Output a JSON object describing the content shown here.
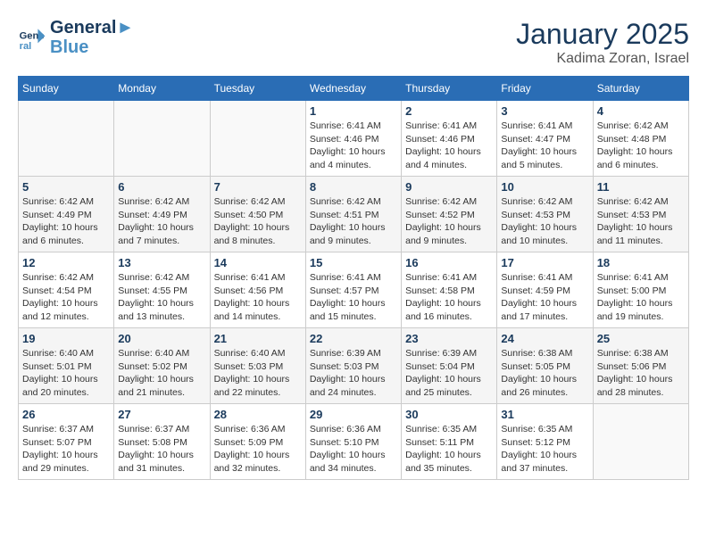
{
  "header": {
    "logo_line1": "General",
    "logo_line2": "Blue",
    "month": "January 2025",
    "location": "Kadima Zoran, Israel"
  },
  "weekdays": [
    "Sunday",
    "Monday",
    "Tuesday",
    "Wednesday",
    "Thursday",
    "Friday",
    "Saturday"
  ],
  "weeks": [
    [
      {
        "day": "",
        "info": ""
      },
      {
        "day": "",
        "info": ""
      },
      {
        "day": "",
        "info": ""
      },
      {
        "day": "1",
        "info": "Sunrise: 6:41 AM\nSunset: 4:46 PM\nDaylight: 10 hours\nand 4 minutes."
      },
      {
        "day": "2",
        "info": "Sunrise: 6:41 AM\nSunset: 4:46 PM\nDaylight: 10 hours\nand 4 minutes."
      },
      {
        "day": "3",
        "info": "Sunrise: 6:41 AM\nSunset: 4:47 PM\nDaylight: 10 hours\nand 5 minutes."
      },
      {
        "day": "4",
        "info": "Sunrise: 6:42 AM\nSunset: 4:48 PM\nDaylight: 10 hours\nand 6 minutes."
      }
    ],
    [
      {
        "day": "5",
        "info": "Sunrise: 6:42 AM\nSunset: 4:49 PM\nDaylight: 10 hours\nand 6 minutes."
      },
      {
        "day": "6",
        "info": "Sunrise: 6:42 AM\nSunset: 4:49 PM\nDaylight: 10 hours\nand 7 minutes."
      },
      {
        "day": "7",
        "info": "Sunrise: 6:42 AM\nSunset: 4:50 PM\nDaylight: 10 hours\nand 8 minutes."
      },
      {
        "day": "8",
        "info": "Sunrise: 6:42 AM\nSunset: 4:51 PM\nDaylight: 10 hours\nand 9 minutes."
      },
      {
        "day": "9",
        "info": "Sunrise: 6:42 AM\nSunset: 4:52 PM\nDaylight: 10 hours\nand 9 minutes."
      },
      {
        "day": "10",
        "info": "Sunrise: 6:42 AM\nSunset: 4:53 PM\nDaylight: 10 hours\nand 10 minutes."
      },
      {
        "day": "11",
        "info": "Sunrise: 6:42 AM\nSunset: 4:53 PM\nDaylight: 10 hours\nand 11 minutes."
      }
    ],
    [
      {
        "day": "12",
        "info": "Sunrise: 6:42 AM\nSunset: 4:54 PM\nDaylight: 10 hours\nand 12 minutes."
      },
      {
        "day": "13",
        "info": "Sunrise: 6:42 AM\nSunset: 4:55 PM\nDaylight: 10 hours\nand 13 minutes."
      },
      {
        "day": "14",
        "info": "Sunrise: 6:41 AM\nSunset: 4:56 PM\nDaylight: 10 hours\nand 14 minutes."
      },
      {
        "day": "15",
        "info": "Sunrise: 6:41 AM\nSunset: 4:57 PM\nDaylight: 10 hours\nand 15 minutes."
      },
      {
        "day": "16",
        "info": "Sunrise: 6:41 AM\nSunset: 4:58 PM\nDaylight: 10 hours\nand 16 minutes."
      },
      {
        "day": "17",
        "info": "Sunrise: 6:41 AM\nSunset: 4:59 PM\nDaylight: 10 hours\nand 17 minutes."
      },
      {
        "day": "18",
        "info": "Sunrise: 6:41 AM\nSunset: 5:00 PM\nDaylight: 10 hours\nand 19 minutes."
      }
    ],
    [
      {
        "day": "19",
        "info": "Sunrise: 6:40 AM\nSunset: 5:01 PM\nDaylight: 10 hours\nand 20 minutes."
      },
      {
        "day": "20",
        "info": "Sunrise: 6:40 AM\nSunset: 5:02 PM\nDaylight: 10 hours\nand 21 minutes."
      },
      {
        "day": "21",
        "info": "Sunrise: 6:40 AM\nSunset: 5:03 PM\nDaylight: 10 hours\nand 22 minutes."
      },
      {
        "day": "22",
        "info": "Sunrise: 6:39 AM\nSunset: 5:03 PM\nDaylight: 10 hours\nand 24 minutes."
      },
      {
        "day": "23",
        "info": "Sunrise: 6:39 AM\nSunset: 5:04 PM\nDaylight: 10 hours\nand 25 minutes."
      },
      {
        "day": "24",
        "info": "Sunrise: 6:38 AM\nSunset: 5:05 PM\nDaylight: 10 hours\nand 26 minutes."
      },
      {
        "day": "25",
        "info": "Sunrise: 6:38 AM\nSunset: 5:06 PM\nDaylight: 10 hours\nand 28 minutes."
      }
    ],
    [
      {
        "day": "26",
        "info": "Sunrise: 6:37 AM\nSunset: 5:07 PM\nDaylight: 10 hours\nand 29 minutes."
      },
      {
        "day": "27",
        "info": "Sunrise: 6:37 AM\nSunset: 5:08 PM\nDaylight: 10 hours\nand 31 minutes."
      },
      {
        "day": "28",
        "info": "Sunrise: 6:36 AM\nSunset: 5:09 PM\nDaylight: 10 hours\nand 32 minutes."
      },
      {
        "day": "29",
        "info": "Sunrise: 6:36 AM\nSunset: 5:10 PM\nDaylight: 10 hours\nand 34 minutes."
      },
      {
        "day": "30",
        "info": "Sunrise: 6:35 AM\nSunset: 5:11 PM\nDaylight: 10 hours\nand 35 minutes."
      },
      {
        "day": "31",
        "info": "Sunrise: 6:35 AM\nSunset: 5:12 PM\nDaylight: 10 hours\nand 37 minutes."
      },
      {
        "day": "",
        "info": ""
      }
    ]
  ]
}
